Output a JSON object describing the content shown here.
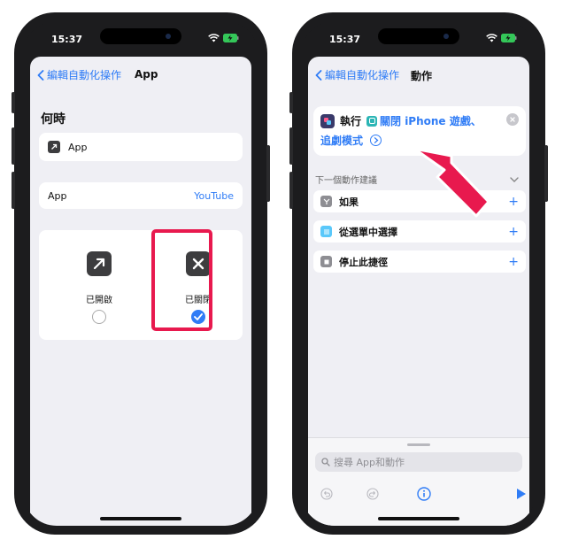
{
  "left_phone": {
    "time": "15:37",
    "nav": {
      "back_label": "編輯自動化操作",
      "title": "App"
    },
    "section_title": "何時",
    "app_row_label": "App",
    "app_select": {
      "label": "App",
      "value": "YouTube"
    },
    "options": [
      {
        "label": "已開啟",
        "icon": "arrow-up-right-icon",
        "selected": false
      },
      {
        "label": "已關閉",
        "icon": "x-mark-icon",
        "selected": true
      }
    ]
  },
  "right_phone": {
    "time": "15:37",
    "nav": {
      "back_label": "編輯自動化操作",
      "title": "動作"
    },
    "action": {
      "run_label": "執行",
      "shortcut_name_line1": "關閉 iPhone 遊戲、",
      "shortcut_name_line2": "追劇模式"
    },
    "suggestions_header": "下一個動作建議",
    "suggestions": [
      {
        "label": "如果",
        "icon": "branch-icon"
      },
      {
        "label": "從選單中選擇",
        "icon": "menu-list-icon"
      },
      {
        "label": "停止此捷徑",
        "icon": "stop-icon"
      }
    ],
    "search_placeholder": "搜尋 App和動作"
  },
  "colors": {
    "accent": "#2f7cf6",
    "highlight": "#e8194e",
    "background": "#efeff4"
  }
}
